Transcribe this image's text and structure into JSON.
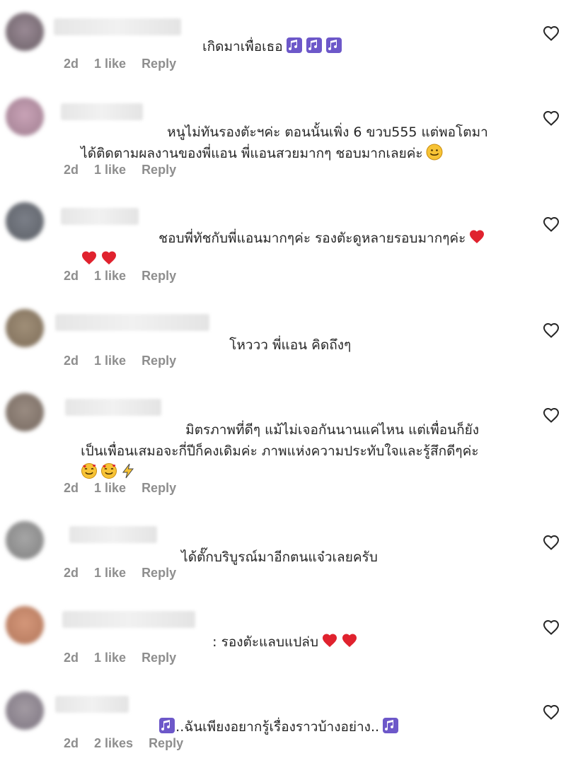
{
  "comments": [
    {
      "line1": "เกิดมาเพื่อเธอ",
      "line2": "",
      "time": "2d",
      "likes": "1 like",
      "reply": "Reply",
      "emojis": "music3"
    },
    {
      "line1": "หนูไม่ทันรองตัะฯค่ะ ตอนนั้นเพิ่ง 6 ขวบ555 แต่พอโตมา",
      "line2": "ได้ติดตามผลงานของพี่แอน พี่แอนสวยมากๆ ชอบมากเลยค่ะ",
      "time": "2d",
      "likes": "1 like",
      "reply": "Reply",
      "emojis": "smile"
    },
    {
      "line1": "ชอบพี่ทัชกับพี่แอนมากๆค่ะ รองตัะดูหลายรอบมากๆค่ะ",
      "line2": "",
      "time": "2d",
      "likes": "1 like",
      "reply": "Reply",
      "emojis": "hearts"
    },
    {
      "line1": "โหววว พี่แอน คิดถึงๆ",
      "line2": "",
      "time": "2d",
      "likes": "1 like",
      "reply": "Reply",
      "emojis": ""
    },
    {
      "line1": "มิตรภาพที่ดีๆ แม้ไม่เจอกันนานแค่ไหน แต่เพื่อนก็ยัง",
      "line2": "เป็นเพื่อนเสมอจะกี่ปีก็คงเดิมค่ะ ภาพแห่งความประทับใจและรู้สึกดีๆค่ะ",
      "time": "2d",
      "likes": "1 like",
      "reply": "Reply",
      "emojis": "love"
    },
    {
      "line1": "ได้ตั๊กบริบูรณ์มาอีกตนแจ๋วเลยครับ",
      "line2": "",
      "time": "2d",
      "likes": "1 like",
      "reply": "Reply",
      "emojis": ""
    },
    {
      "line1": ": รองตัะแลบแปล่บ",
      "line2": "",
      "time": "2d",
      "likes": "1 like",
      "reply": "Reply",
      "emojis": "hearts2"
    },
    {
      "line1": "..ฉันเพียงอยากรู้เรื่องราวบ้างอย่าง..",
      "line2": "",
      "time": "2d",
      "likes": "2 likes",
      "reply": "Reply",
      "emojis": "music2"
    }
  ],
  "colors": {
    "text": "#262626",
    "meta": "#8e8e8e",
    "heart": "#e0222e",
    "music": "#5a3fb0"
  }
}
